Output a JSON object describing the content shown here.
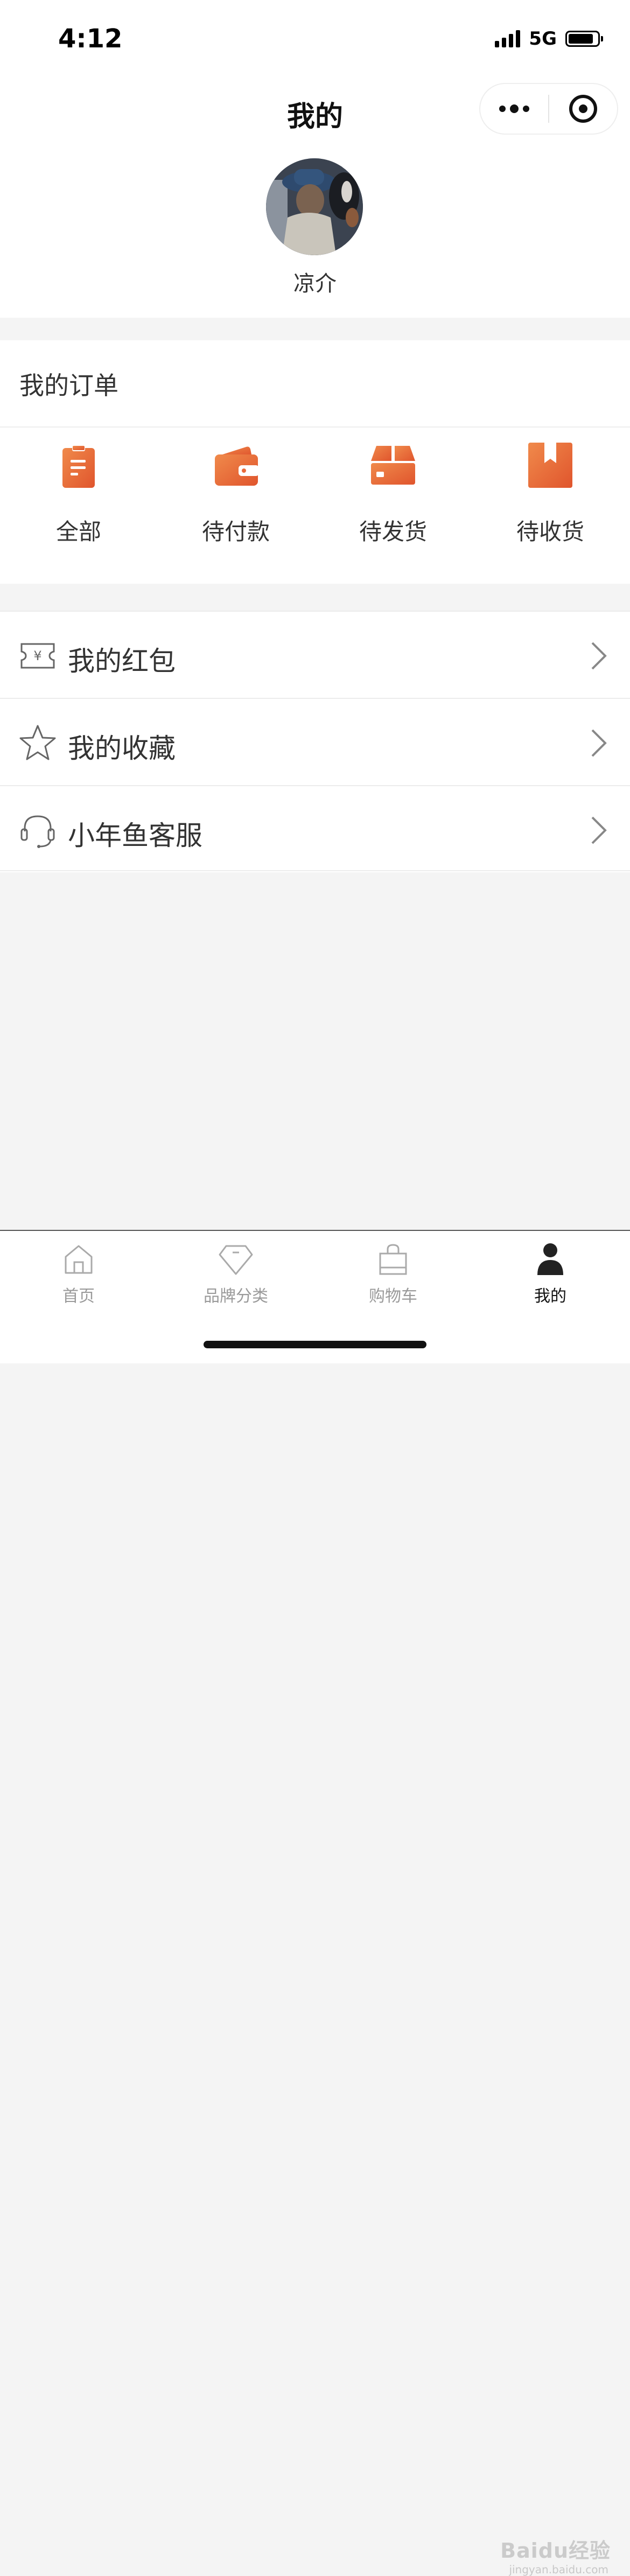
{
  "status_bar": {
    "time": "4:12",
    "network": "5G"
  },
  "nav": {
    "title": "我的"
  },
  "profile": {
    "username": "凉介"
  },
  "orders": {
    "title": "我的订单",
    "items": [
      {
        "label": "全部",
        "icon": "clipboard-icon"
      },
      {
        "label": "待付款",
        "icon": "wallet-icon"
      },
      {
        "label": "待发货",
        "icon": "package-icon"
      },
      {
        "label": "待收货",
        "icon": "bookmark-icon"
      }
    ]
  },
  "menu": {
    "items": [
      {
        "label": "我的红包",
        "icon": "coupon-icon"
      },
      {
        "label": "我的收藏",
        "icon": "star-icon"
      },
      {
        "label": "小年鱼客服",
        "icon": "headset-icon"
      }
    ]
  },
  "tab_bar": {
    "items": [
      {
        "label": "首页",
        "icon": "home-icon",
        "active": false
      },
      {
        "label": "品牌分类",
        "icon": "diamond-icon",
        "active": false
      },
      {
        "label": "购物车",
        "icon": "shopping-bag-icon",
        "active": false
      },
      {
        "label": "我的",
        "icon": "user-icon",
        "active": true
      }
    ]
  },
  "watermark": {
    "text": "Baidu经验",
    "sub": "jingyan.baidu.com"
  },
  "colors": {
    "accent": "#e96b3c",
    "background": "#f4f4f4"
  }
}
